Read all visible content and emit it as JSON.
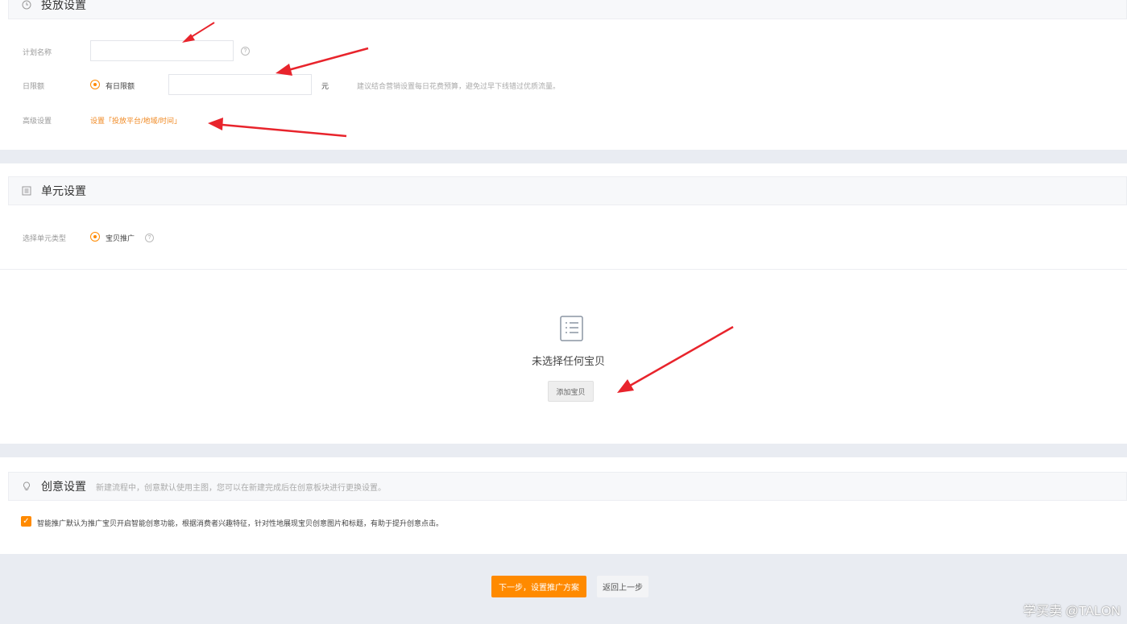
{
  "delivery": {
    "title": "投放设置",
    "plan_name_label": "计划名称",
    "plan_name_value": "",
    "budget_label": "日限额",
    "budget_option": "有日限额",
    "budget_value": "",
    "budget_unit": "元",
    "budget_hint": "建议结合营销设置每日花费预算，避免过早下线错过优质流量。",
    "advanced_label": "高级设置",
    "advanced_link": "设置「投放平台/地域/时间」"
  },
  "unit": {
    "title": "单元设置",
    "type_label": "选择单元类型",
    "type_option": "宝贝推广",
    "empty_text": "未选择任何宝贝",
    "add_button": "添加宝贝"
  },
  "creative": {
    "title": "创意设置",
    "desc": "新建流程中，创意默认使用主图，您可以在新建完成后在创意板块进行更换设置。",
    "checkbox_text": "智能推广默认为推广宝贝开启智能创意功能，根据消费者兴趣特征，针对性地展现宝贝创意图片和标题，有助于提升创意点击。"
  },
  "footer": {
    "next_button": "下一步，设置推广方案",
    "back_button": "返回上一步"
  },
  "watermark": "学买卖 @TALON",
  "colors": {
    "accent": "#ff8a00",
    "link": "#f08a24",
    "arrow": "#e8242c"
  }
}
